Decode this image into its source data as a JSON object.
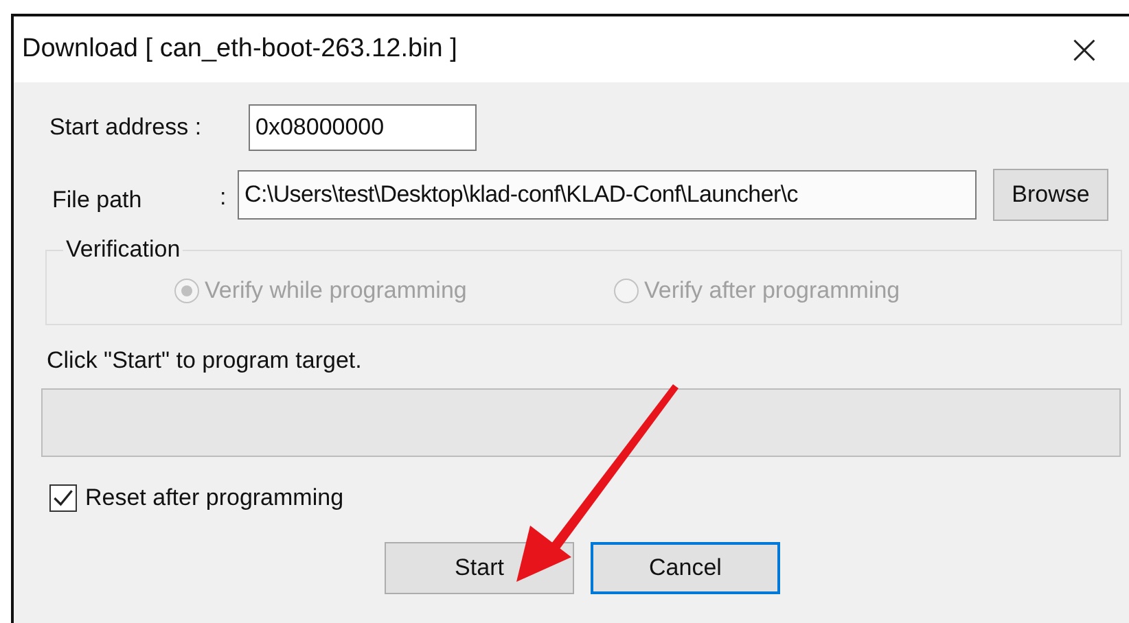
{
  "window": {
    "title": "Download [ can_eth-boot-263.12.bin ]",
    "close": "×"
  },
  "start_address": {
    "label": "Start address :",
    "value": "0x08000000"
  },
  "file_path": {
    "label": "File path",
    "separator": ":",
    "value": "C:\\Users\\test\\Desktop\\klad-conf\\KLAD-Conf\\Launcher\\c",
    "button": "Browse"
  },
  "verification": {
    "title": "Verification",
    "disabled": true,
    "options": [
      {
        "label": "Verify while programming",
        "selected": true
      },
      {
        "label": "Verify after programming",
        "selected": false
      }
    ]
  },
  "status": "Click \"Start\" to program target.",
  "progress": {
    "level": 0
  },
  "reset": {
    "label": "Reset after programming",
    "checked": true
  },
  "buttons": [
    {
      "label": "Start",
      "default": false
    },
    {
      "label": "Cancel",
      "default": true
    }
  ]
}
